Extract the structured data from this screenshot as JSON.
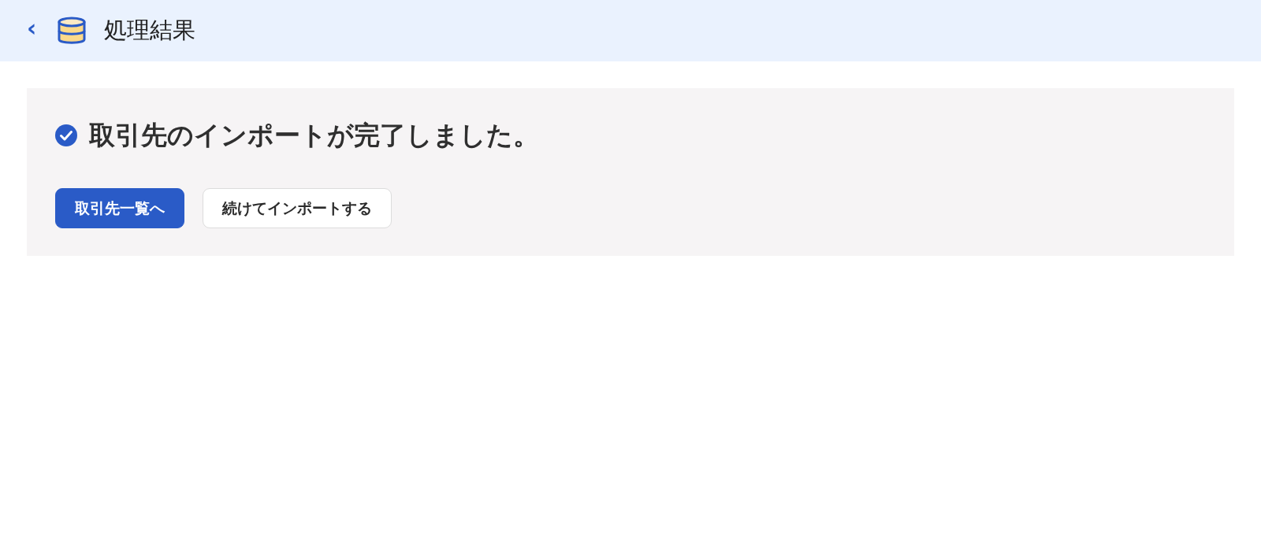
{
  "header": {
    "back": "‹",
    "title": "処理結果"
  },
  "result": {
    "message": "取引先のインポートが完了しました。",
    "buttons": [
      {
        "label": "取引先一覧へ",
        "kind": "primary"
      },
      {
        "label": "続けてインポートする",
        "kind": "secondary"
      }
    ]
  }
}
